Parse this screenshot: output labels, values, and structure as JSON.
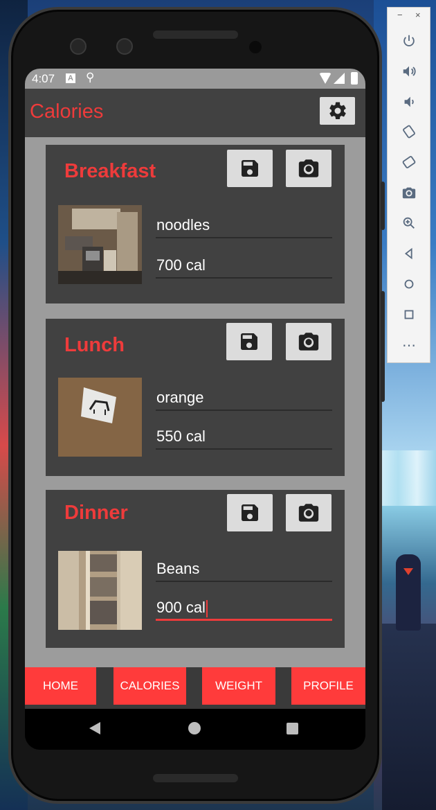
{
  "status_bar": {
    "time": "4:07",
    "notif_a": "A",
    "notif_b": "⚲"
  },
  "app_bar": {
    "title": "Calories",
    "settings_icon": "gear-icon"
  },
  "meals": [
    {
      "title": "Breakfast",
      "food": "noodles",
      "calories": "700 cal",
      "photo": "kitchen photo"
    },
    {
      "title": "Lunch",
      "food": "orange",
      "calories": "550 cal",
      "photo": "zebra picture on wall"
    },
    {
      "title": "Dinner",
      "food": "Beans",
      "calories": "900 cal",
      "photo": "bookshelf photo"
    }
  ],
  "nav": {
    "home": "HOME",
    "calories": "CALORIES",
    "weight": "WEIGHT",
    "profile": "PROFILE"
  },
  "emulator_panel": {
    "minimize": "−",
    "close": "×",
    "more": "⋯"
  },
  "colors": {
    "accent": "#ee3b3b",
    "card_bg": "#414141",
    "content_bg": "#9c9c9c"
  }
}
